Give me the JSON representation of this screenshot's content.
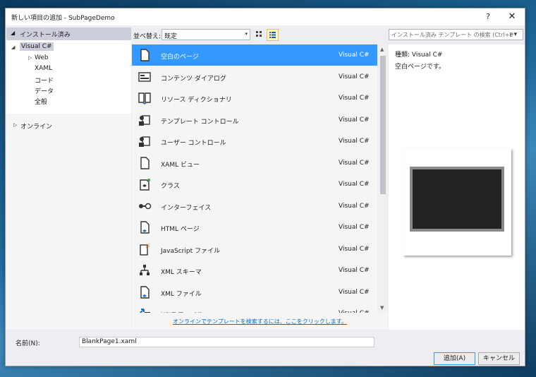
{
  "window": {
    "title": "新しい項目の追加 - SubPageDemo",
    "help": "?",
    "close": "✕"
  },
  "left": {
    "header": "インストール済み",
    "tree": [
      {
        "label": "Visual C#"
      },
      {
        "label": "Web"
      },
      {
        "label": "XAML"
      },
      {
        "label": "コード"
      },
      {
        "label": "データ"
      },
      {
        "label": "全般"
      }
    ],
    "online": "オンライン"
  },
  "toolbar": {
    "sort_label": "並べ替え:",
    "sort_value": "既定",
    "search_placeholder": "インストール済み テンプレート の検索 (Ctrl+E"
  },
  "templates": [
    {
      "name": "空白のページ",
      "lang": "Visual C#",
      "icon": "blank-page-icon",
      "selected": true
    },
    {
      "name": "コンテンツ ダイアログ",
      "lang": "Visual C#",
      "icon": "content-dialog-icon"
    },
    {
      "name": "リソース ディクショナリ",
      "lang": "Visual C#",
      "icon": "resource-dictionary-icon"
    },
    {
      "name": "テンプレート コントロール",
      "lang": "Visual C#",
      "icon": "templated-control-icon"
    },
    {
      "name": "ユーザー コントロール",
      "lang": "Visual C#",
      "icon": "user-control-icon"
    },
    {
      "name": "XAML ビュー",
      "lang": "Visual C#",
      "icon": "xaml-view-icon"
    },
    {
      "name": "クラス",
      "lang": "Visual C#",
      "icon": "class-icon"
    },
    {
      "name": "インターフェイス",
      "lang": "Visual C#",
      "icon": "interface-icon"
    },
    {
      "name": "HTML ページ",
      "lang": "Visual C#",
      "icon": "html-page-icon"
    },
    {
      "name": "JavaScript ファイル",
      "lang": "Visual C#",
      "icon": "javascript-file-icon"
    },
    {
      "name": "XML スキーマ",
      "lang": "Visual C#",
      "icon": "xml-schema-icon"
    },
    {
      "name": "XML ファイル",
      "lang": "Visual C#",
      "icon": "xml-file-icon"
    },
    {
      "name": "XSLT ファイル",
      "lang": "Visual C#",
      "icon": "xslt-file-icon"
    }
  ],
  "online_link": "オンラインでテンプレートを検索するには、ここをクリックします。",
  "details": {
    "type": "種類:  Visual C#",
    "description": "空白ページです。"
  },
  "name_field": {
    "label": "名前(N):",
    "value": "BlankPage1.xaml"
  },
  "buttons": {
    "add": "追加(A)",
    "cancel": "キャンセル"
  },
  "colors": {
    "selection": "#3399ff",
    "link": "#0e70c0",
    "panel_header": "#cccedb"
  }
}
